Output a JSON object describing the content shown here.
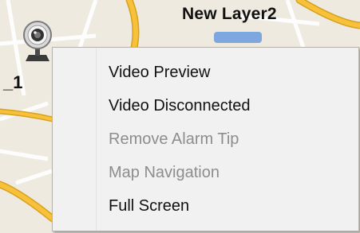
{
  "map": {
    "layer_title": "New Layer2",
    "colors": {
      "background": "#efeadf",
      "major_road": "#f7c23a",
      "road_outline": "#d8a020",
      "minor_road": "#ffffff",
      "accent_blue": "#7ea7e0"
    }
  },
  "camera_device": {
    "icon": "webcam-icon",
    "label": "_1"
  },
  "context_menu": {
    "items": [
      {
        "label": "Video Preview",
        "enabled": true
      },
      {
        "label": "Video Disconnected",
        "enabled": true
      },
      {
        "label": "Remove Alarm Tip",
        "enabled": false
      },
      {
        "label": "Map Navigation",
        "enabled": false
      },
      {
        "label": "Full Screen",
        "enabled": true
      }
    ]
  }
}
